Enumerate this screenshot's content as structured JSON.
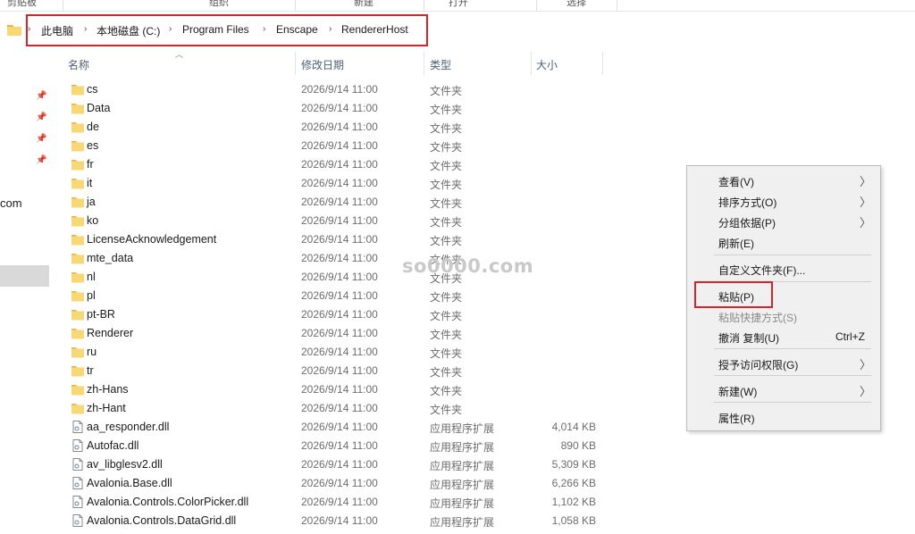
{
  "ribbon": {
    "labels": [
      "剪贴板",
      "组织",
      "新建",
      "打开",
      "选择"
    ]
  },
  "address": {
    "crumbs": [
      "此电脑",
      "本地磁盘 (C:)",
      "Program Files",
      "Enscape",
      "RendererHost"
    ]
  },
  "columns": {
    "name": "名称",
    "date": "修改日期",
    "type": "类型",
    "size": "大小"
  },
  "nav": {
    "fragment": "com"
  },
  "files": [
    {
      "name": "cs",
      "date": "2026/9/14 11:00",
      "type": "文件夹",
      "size": "",
      "icon": "folder-icon"
    },
    {
      "name": "Data",
      "date": "2026/9/14 11:00",
      "type": "文件夹",
      "size": "",
      "icon": "folder-icon"
    },
    {
      "name": "de",
      "date": "2026/9/14 11:00",
      "type": "文件夹",
      "size": "",
      "icon": "folder-icon"
    },
    {
      "name": "es",
      "date": "2026/9/14 11:00",
      "type": "文件夹",
      "size": "",
      "icon": "folder-icon"
    },
    {
      "name": "fr",
      "date": "2026/9/14 11:00",
      "type": "文件夹",
      "size": "",
      "icon": "folder-icon"
    },
    {
      "name": "it",
      "date": "2026/9/14 11:00",
      "type": "文件夹",
      "size": "",
      "icon": "folder-icon"
    },
    {
      "name": "ja",
      "date": "2026/9/14 11:00",
      "type": "文件夹",
      "size": "",
      "icon": "folder-icon"
    },
    {
      "name": "ko",
      "date": "2026/9/14 11:00",
      "type": "文件夹",
      "size": "",
      "icon": "folder-icon"
    },
    {
      "name": "LicenseAcknowledgement",
      "date": "2026/9/14 11:00",
      "type": "文件夹",
      "size": "",
      "icon": "folder-icon"
    },
    {
      "name": "mte_data",
      "date": "2026/9/14 11:00",
      "type": "文件夹",
      "size": "",
      "icon": "folder-icon"
    },
    {
      "name": "nl",
      "date": "2026/9/14 11:00",
      "type": "文件夹",
      "size": "",
      "icon": "folder-icon"
    },
    {
      "name": "pl",
      "date": "2026/9/14 11:00",
      "type": "文件夹",
      "size": "",
      "icon": "folder-icon"
    },
    {
      "name": "pt-BR",
      "date": "2026/9/14 11:00",
      "type": "文件夹",
      "size": "",
      "icon": "folder-icon"
    },
    {
      "name": "Renderer",
      "date": "2026/9/14 11:00",
      "type": "文件夹",
      "size": "",
      "icon": "folder-icon"
    },
    {
      "name": "ru",
      "date": "2026/9/14 11:00",
      "type": "文件夹",
      "size": "",
      "icon": "folder-icon"
    },
    {
      "name": "tr",
      "date": "2026/9/14 11:00",
      "type": "文件夹",
      "size": "",
      "icon": "folder-icon"
    },
    {
      "name": "zh-Hans",
      "date": "2026/9/14 11:00",
      "type": "文件夹",
      "size": "",
      "icon": "folder-icon"
    },
    {
      "name": "zh-Hant",
      "date": "2026/9/14 11:00",
      "type": "文件夹",
      "size": "",
      "icon": "folder-icon"
    },
    {
      "name": "aa_responder.dll",
      "date": "2026/9/14 11:00",
      "type": "应用程序扩展",
      "size": "4,014 KB",
      "icon": "dll-file-icon"
    },
    {
      "name": "Autofac.dll",
      "date": "2026/9/14 11:00",
      "type": "应用程序扩展",
      "size": "890 KB",
      "icon": "dll-file-icon"
    },
    {
      "name": "av_libglesv2.dll",
      "date": "2026/9/14 11:00",
      "type": "应用程序扩展",
      "size": "5,309 KB",
      "icon": "dll-file-icon"
    },
    {
      "name": "Avalonia.Base.dll",
      "date": "2026/9/14 11:00",
      "type": "应用程序扩展",
      "size": "6,266 KB",
      "icon": "dll-file-icon"
    },
    {
      "name": "Avalonia.Controls.ColorPicker.dll",
      "date": "2026/9/14 11:00",
      "type": "应用程序扩展",
      "size": "1,102 KB",
      "icon": "dll-file-icon"
    },
    {
      "name": "Avalonia.Controls.DataGrid.dll",
      "date": "2026/9/14 11:00",
      "type": "应用程序扩展",
      "size": "1,058 KB",
      "icon": "dll-file-icon"
    }
  ],
  "watermark": "so0000.com",
  "context_menu": {
    "items": [
      {
        "label": "查看(V)",
        "submenu": true,
        "disabled": false,
        "shortcut": ""
      },
      {
        "label": "排序方式(O)",
        "submenu": true,
        "disabled": false,
        "shortcut": ""
      },
      {
        "label": "分组依据(P)",
        "submenu": true,
        "disabled": false,
        "shortcut": ""
      },
      {
        "label": "刷新(E)",
        "submenu": false,
        "disabled": false,
        "shortcut": ""
      },
      {
        "label": "自定义文件夹(F)...",
        "submenu": false,
        "disabled": false,
        "shortcut": ""
      },
      {
        "label": "粘贴(P)",
        "submenu": false,
        "disabled": false,
        "shortcut": ""
      },
      {
        "label": "粘贴快捷方式(S)",
        "submenu": false,
        "disabled": true,
        "shortcut": ""
      },
      {
        "label": "撤消 复制(U)",
        "submenu": false,
        "disabled": false,
        "shortcut": "Ctrl+Z"
      },
      {
        "label": "授予访问权限(G)",
        "submenu": true,
        "disabled": false,
        "shortcut": ""
      },
      {
        "label": "新建(W)",
        "submenu": true,
        "disabled": false,
        "shortcut": ""
      },
      {
        "label": "属性(R)",
        "submenu": false,
        "disabled": false,
        "shortcut": ""
      }
    ]
  },
  "colors": {
    "highlight_box": "#d8232a",
    "folder_yellow": "#f8d775"
  }
}
